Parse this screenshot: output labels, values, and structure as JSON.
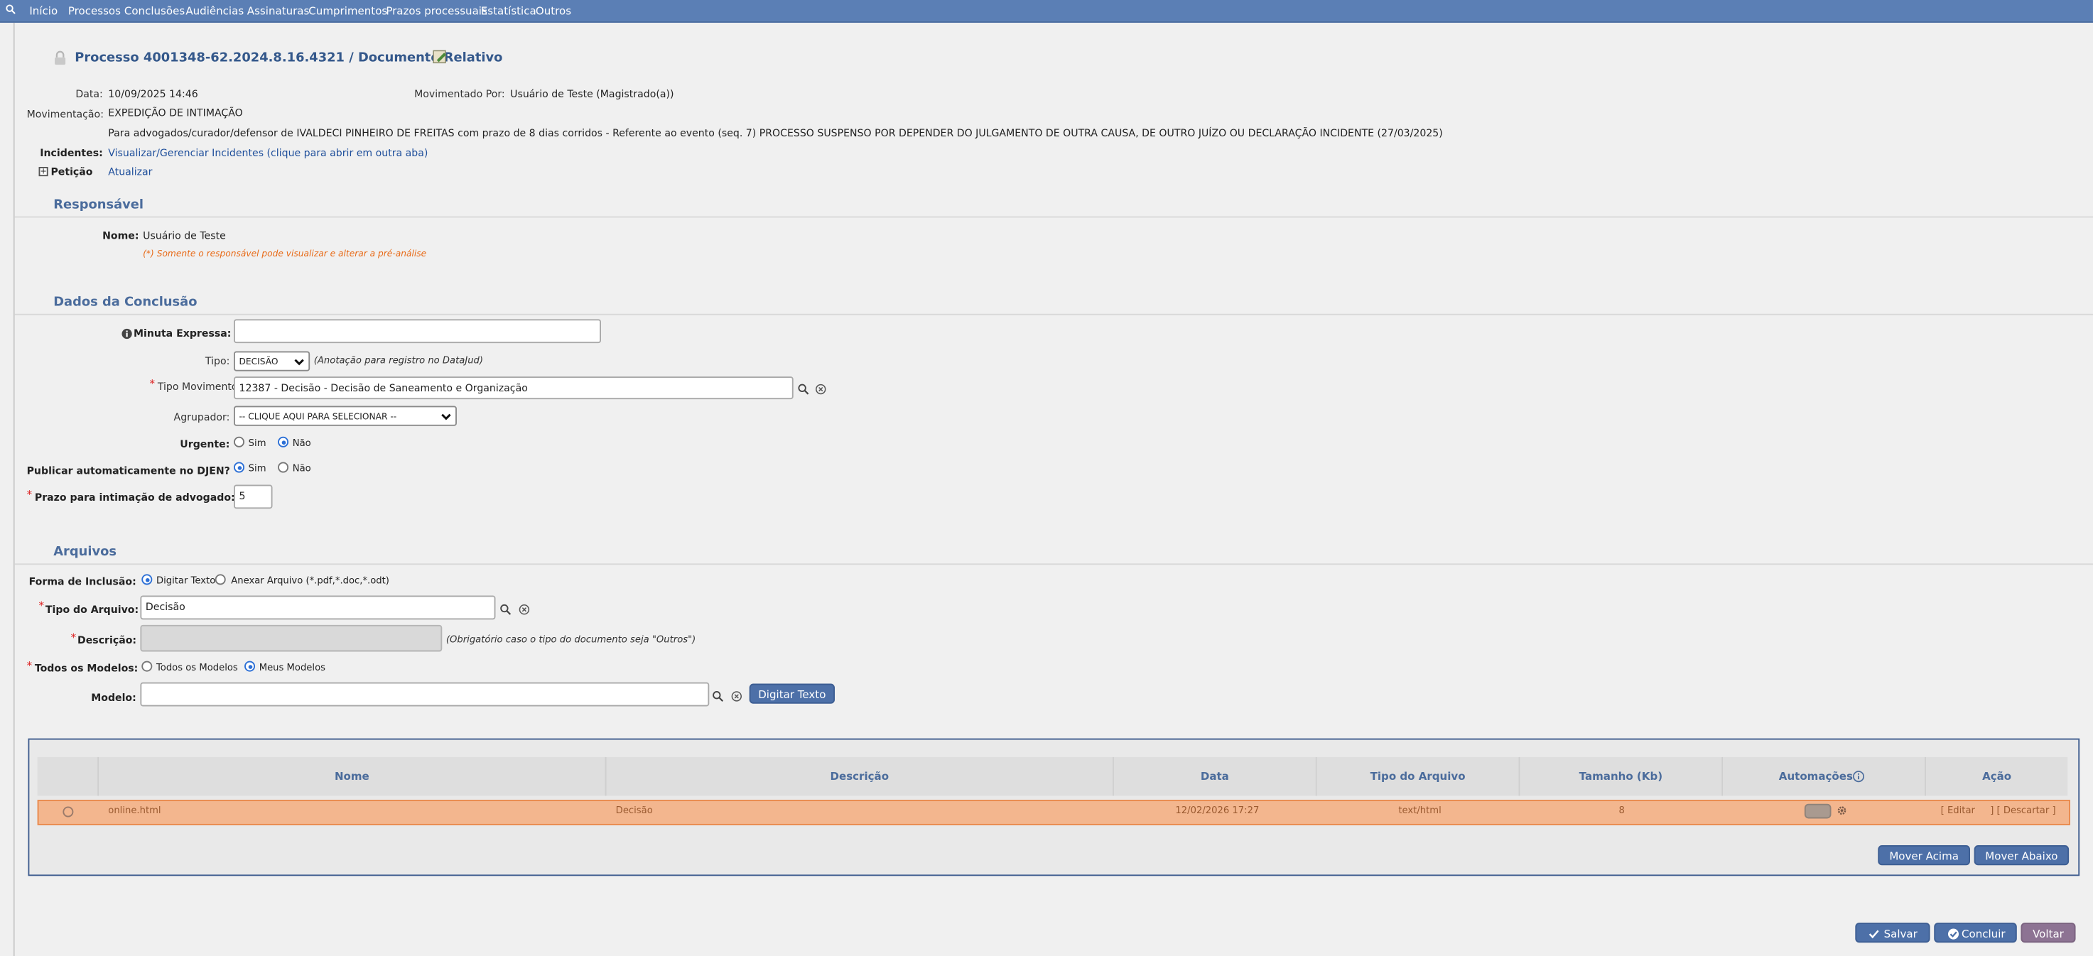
{
  "nav": {
    "items": [
      "Início",
      "Processos",
      "Conclusões",
      "Audiências",
      "Assinaturas",
      "Cumprimentos",
      "Prazos processuais",
      "Estatística",
      "Outros"
    ]
  },
  "header": {
    "title": "Processo 4001348-62.2024.8.16.4321 / Documento Relativo"
  },
  "info": {
    "data_label": "Data:",
    "data_value": "10/09/2025 14:46",
    "movimentado_label": "Movimentado Por:",
    "movimentado_value": "Usuário de Teste (Magistrado(a))",
    "movimentacao_label": "Movimentação:",
    "movimentacao_value": "EXPEDIÇÃO DE INTIMAÇÃO",
    "movimentacao_detail": "Para advogados/curador/defensor de IVALDECI PINHEIRO DE FREITAS com prazo de 8 dias corridos - Referente ao evento (seq. 7) PROCESSO SUSPENSO POR DEPENDER DO JULGAMENTO DE OUTRA CAUSA, DE OUTRO JUÍZO OU DECLARAÇÃO INCIDENTE (27/03/2025)",
    "incidentes_label": "Incidentes:",
    "incidentes_link": "Visualizar/Gerenciar Incidentes (clique para abrir em outra aba)",
    "peticao_label": "Petição",
    "peticao_toggle": "+",
    "atualizar_link": "Atualizar"
  },
  "responsavel": {
    "section_title": "Responsável",
    "nome_label": "Nome:",
    "nome_value": "Usuário de Teste",
    "hint": "(*) Somente o responsável pode visualizar e alterar a pré-análise"
  },
  "conclusao": {
    "section_title": "Dados da Conclusão",
    "minuta_label": "Minuta Expressa:",
    "minuta_value": "",
    "tipo_label": "Tipo:",
    "tipo_value": "DECISÃO",
    "tipo_note": "(Anotação para registro no DataJud)",
    "tipo_mov_label": "Tipo Movimento:",
    "tipo_mov_value": "12387 - Decisão - Decisão de Saneamento e Organização",
    "agrupador_label": "Agrupador:",
    "agrupador_value": "-- CLIQUE AQUI PARA SELECIONAR --",
    "urgente_label": "Urgente:",
    "urgente_sim": "Sim",
    "urgente_nao": "Não",
    "djen_label": "Publicar automaticamente no DJEN?",
    "djen_sim": "Sim",
    "djen_nao": "Não",
    "prazo_label": "Prazo para intimação de advogado:",
    "prazo_value": "5",
    "required_mark": "*"
  },
  "arquivos": {
    "section_title": "Arquivos",
    "forma_label": "Forma de Inclusão:",
    "forma_digitar": "Digitar Texto",
    "forma_anexar": "Anexar Arquivo (*.pdf,*.doc,*.odt)",
    "tipo_arquivo_label": "Tipo do Arquivo:",
    "tipo_arquivo_value": "Decisão",
    "descricao_label": "Descrição:",
    "descricao_note": "(Obrigatório caso o tipo do documento seja \"Outros\")",
    "modelos_label": "Todos os Modelos:",
    "modelos_todos": "Todos os Modelos",
    "modelos_meus": "Meus Modelos",
    "modelo_label": "Modelo:",
    "modelo_value": "",
    "digitar_button": "Digitar Texto"
  },
  "table": {
    "headers": [
      "Nome",
      "Descrição",
      "Data",
      "Tipo do Arquivo",
      "Tamanho (Kb)",
      "Automações",
      "Ação"
    ],
    "row": {
      "nome": "online.html",
      "descricao": "Decisão",
      "data": "12/02/2026 17:27",
      "tipo": "text/html",
      "tamanho": "8",
      "editar": "[ Editar",
      "descartar": "] [ Descartar ]"
    },
    "mover_acima": "Mover Acima",
    "mover_abaixo": "Mover Abaixo"
  },
  "footer": {
    "salvar": "Salvar",
    "concluir": "Concluir",
    "voltar": "Voltar"
  },
  "colors": {
    "nav_bg": "#5b7fb5",
    "section_title": "#4b6c9c",
    "row_highlight": "#f3b68e",
    "button": "#4d70a8",
    "voltar_button": "#8d7393",
    "hint": "#e86a17"
  }
}
